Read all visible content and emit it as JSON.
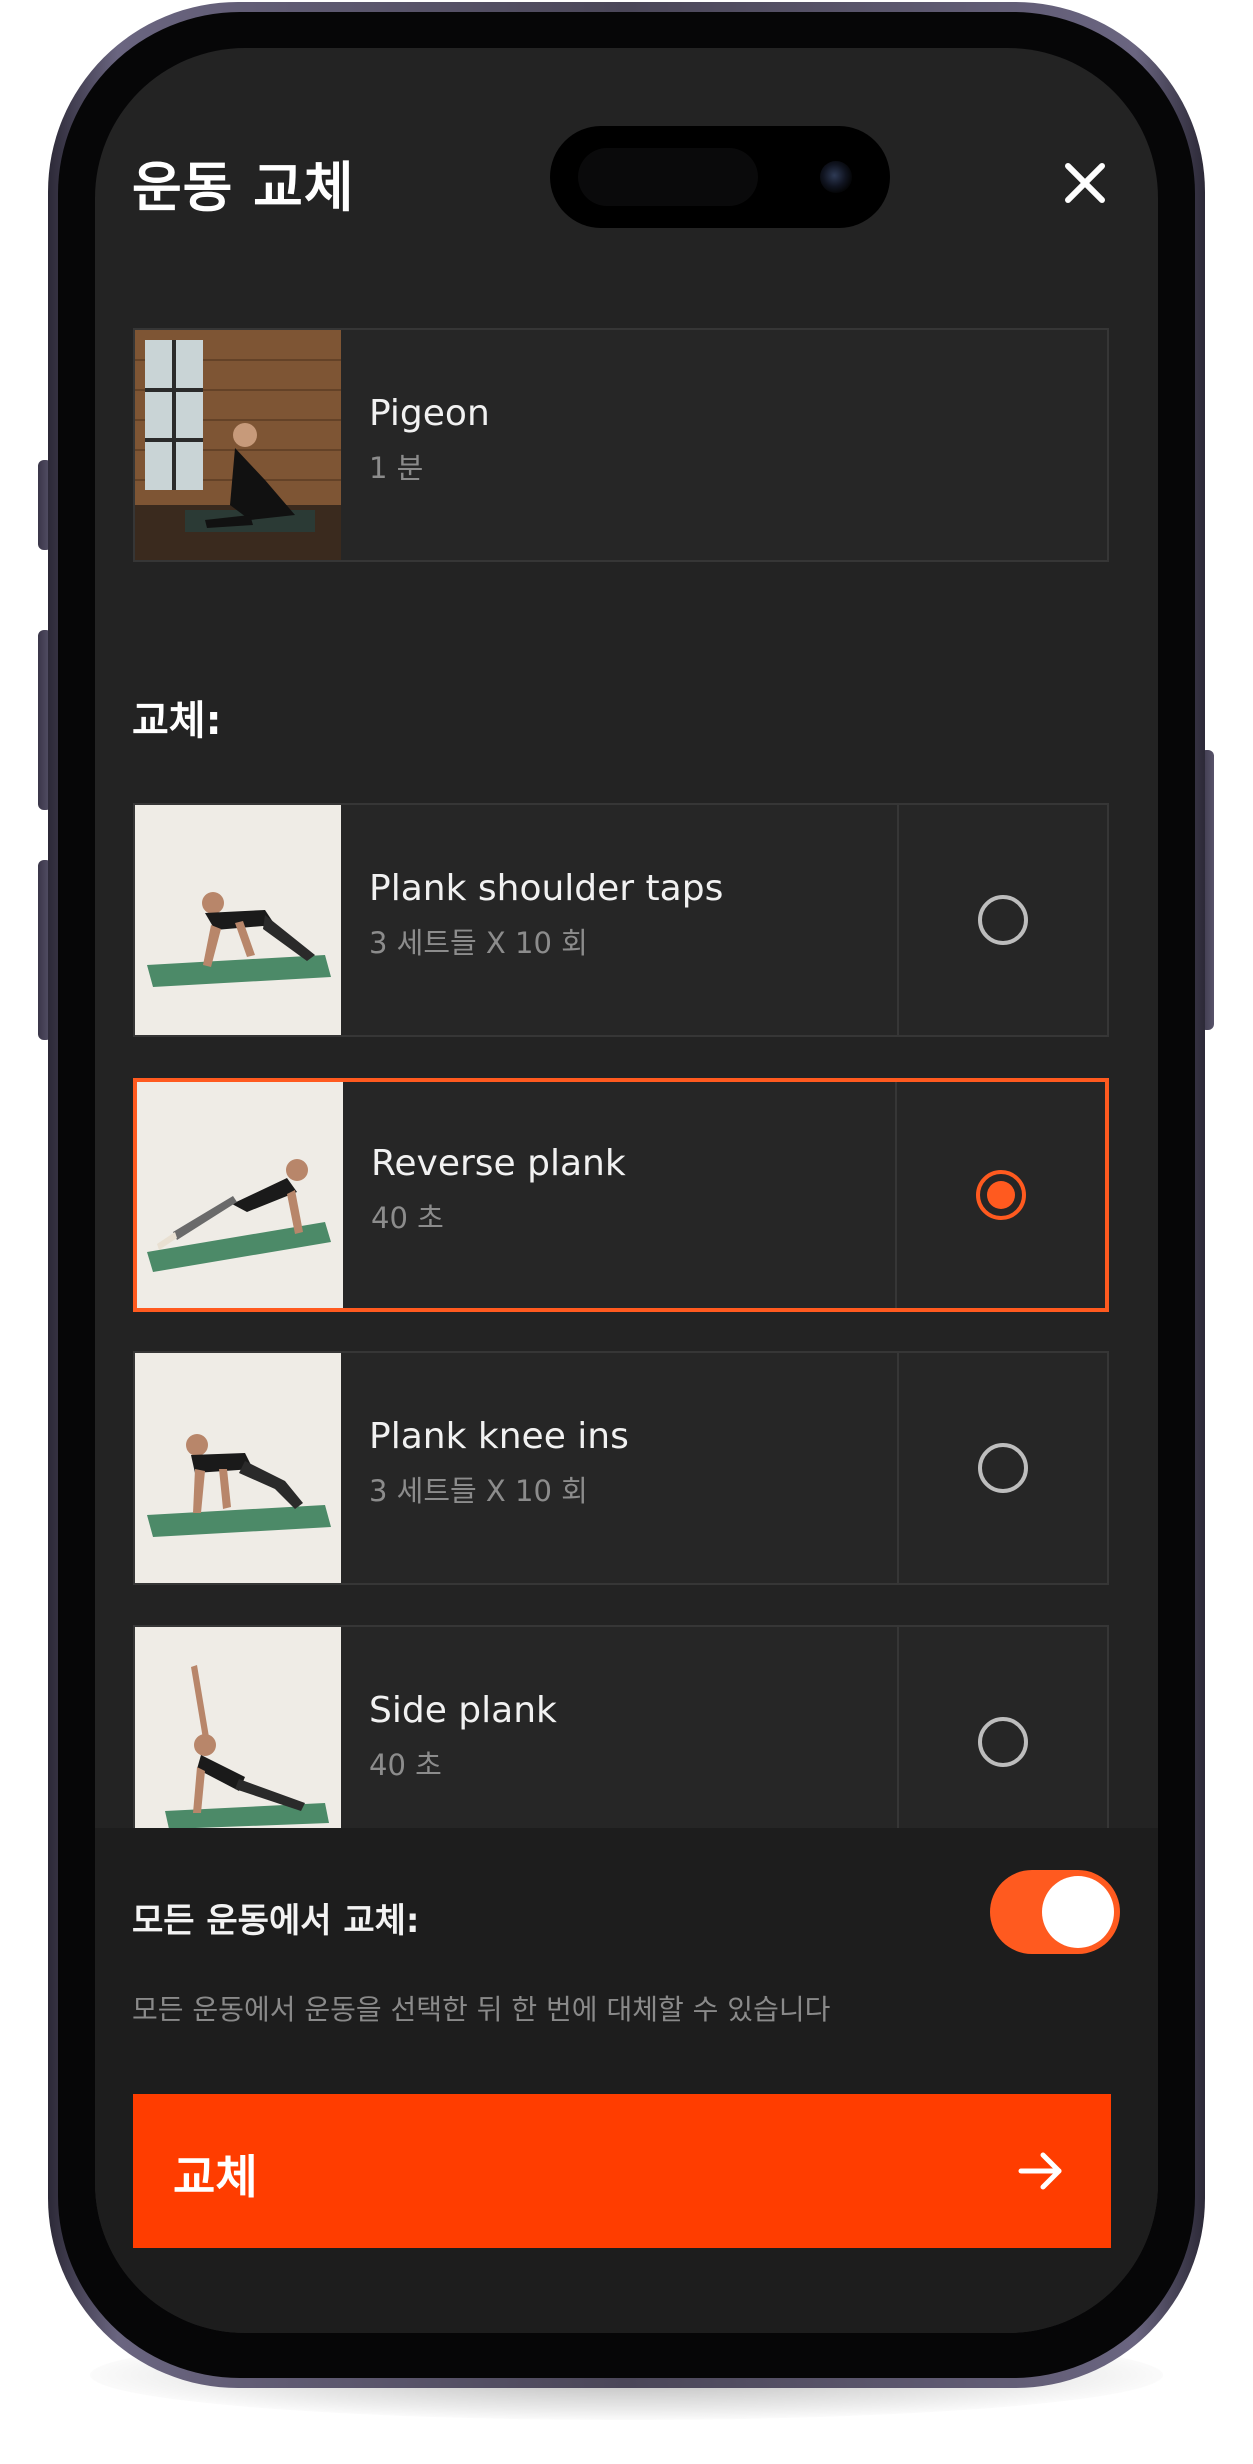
{
  "header": {
    "title": "운동 교체"
  },
  "current_exercise": {
    "name": "Pigeon",
    "duration": "1 분"
  },
  "replace_section_label": "교체:",
  "alternatives": [
    {
      "name": "Plank shoulder taps",
      "detail": "3 세트들 X 10 회",
      "selected": false
    },
    {
      "name": "Reverse plank",
      "detail": "40 초",
      "selected": true
    },
    {
      "name": "Plank knee ins",
      "detail": "3 세트들 X 10 회",
      "selected": false
    },
    {
      "name": "Side plank",
      "detail": "40 초",
      "selected": false
    }
  ],
  "replace_all": {
    "label": "모든 운동에서 교체:",
    "description": "모든 운동에서 운동을 선택한 뒤 한 번에 대체할 수 있습니다",
    "enabled": true
  },
  "primary_button": {
    "label": "교체"
  },
  "colors": {
    "accent": "#ff5a1f",
    "button": "#ff3d00",
    "background": "#232323"
  },
  "icons": {
    "close": "close-icon",
    "arrow": "arrow-right-icon",
    "radio": "radio-icon"
  }
}
